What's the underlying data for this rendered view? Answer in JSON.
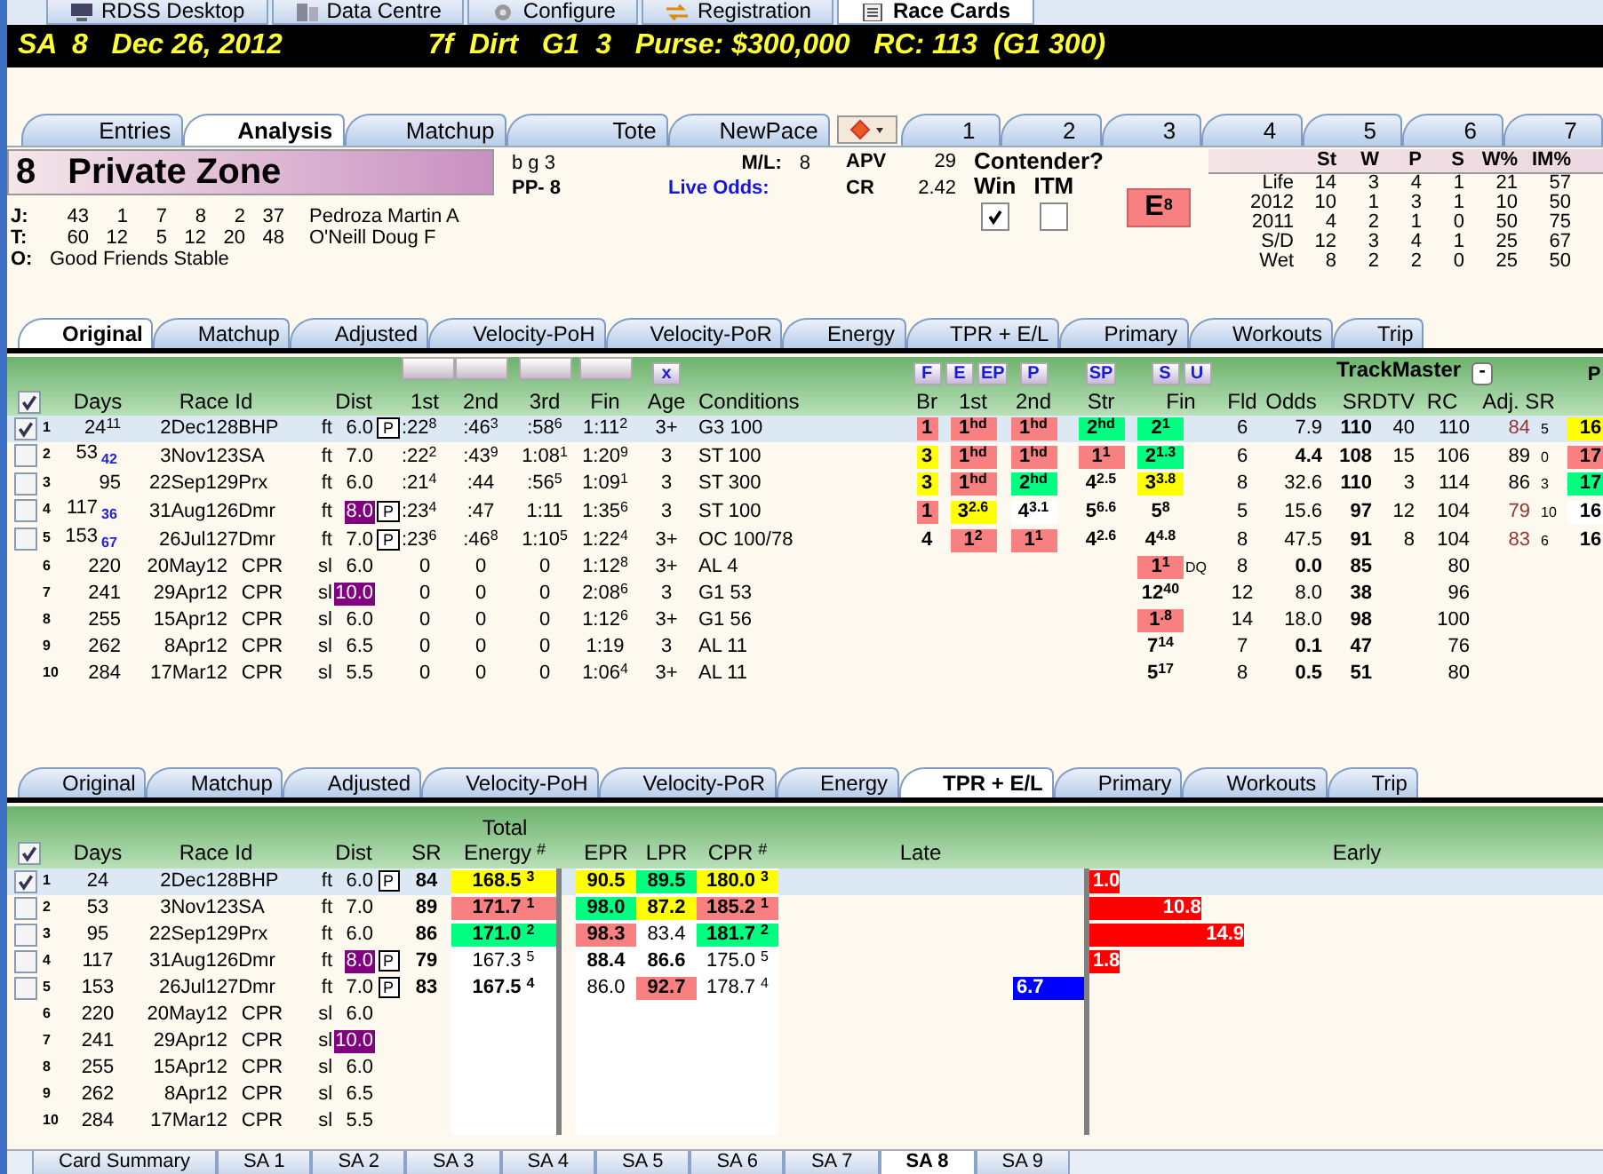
{
  "app_tabs": [
    {
      "label": "RDSS Desktop",
      "selected": false
    },
    {
      "label": "Data Centre",
      "selected": false
    },
    {
      "label": "Configure",
      "selected": false
    },
    {
      "label": "Registration",
      "selected": false
    },
    {
      "label": "Race Cards",
      "selected": true
    }
  ],
  "race_header": {
    "left": "SA  8   Dec 26, 2012",
    "right": "7f  Dirt   G1  3   Purse: $300,000   RC: 113  (G1 300)"
  },
  "horse_tabs": [
    {
      "label": "Entries",
      "selected": false
    },
    {
      "label": "Analysis",
      "selected": true
    },
    {
      "label": "Matchup",
      "selected": false
    },
    {
      "label": "Tote",
      "selected": false
    },
    {
      "label": "NewPace",
      "selected": false
    }
  ],
  "number_tabs": [
    {
      "label": "1",
      "selected": false
    },
    {
      "label": "2",
      "selected": false
    },
    {
      "label": "3",
      "selected": false
    },
    {
      "label": "4",
      "selected": false
    },
    {
      "label": "5",
      "selected": false
    },
    {
      "label": "6",
      "selected": false
    },
    {
      "label": "7",
      "selected": false
    }
  ],
  "horse": {
    "number": "8",
    "name": "Private Zone",
    "description": "b g 3",
    "post": "PP- 8",
    "ml_label": "M/L:",
    "ml": "8",
    "live_odds_label": "Live Odds:",
    "apv_label": "APV",
    "apv": "29",
    "cr_label": "CR",
    "cr": "2.42",
    "contender_label": "Contender?",
    "win_label": "Win",
    "win_checked": true,
    "itm_label": "ITM",
    "itm_checked": false,
    "style": "E",
    "style_number": "8",
    "connections": [
      {
        "label": "J:",
        "stats": [
          "43",
          "1",
          "7",
          "8",
          "2",
          "37"
        ],
        "name": "Pedroza Martin A"
      },
      {
        "label": "T:",
        "stats": [
          "60",
          "12",
          "5",
          "12",
          "20",
          "48"
        ],
        "name": "O'Neill Doug F"
      }
    ],
    "owner_label": "O:",
    "owner": "Good Friends Stable"
  },
  "record": {
    "columns": [
      "St",
      "W",
      "P",
      "S",
      "W%",
      "IM%"
    ],
    "rows": [
      {
        "label": "Life",
        "values": [
          "14",
          "3",
          "4",
          "1",
          "21",
          "57"
        ]
      },
      {
        "label": "2012",
        "values": [
          "10",
          "1",
          "3",
          "1",
          "10",
          "50"
        ]
      },
      {
        "label": "2011",
        "values": [
          "4",
          "2",
          "1",
          "0",
          "50",
          "75"
        ]
      },
      {
        "label": "S/D",
        "values": [
          "12",
          "3",
          "4",
          "1",
          "25",
          "67"
        ]
      },
      {
        "label": "Wet",
        "values": [
          "8",
          "2",
          "2",
          "0",
          "25",
          "50"
        ]
      }
    ]
  },
  "original_table": {
    "tabs": [
      {
        "label": "Original",
        "selected": true
      },
      {
        "label": "Matchup",
        "selected": false
      },
      {
        "label": "Adjusted",
        "selected": false
      },
      {
        "label": "Velocity-PoH",
        "selected": false
      },
      {
        "label": "Velocity-PoR",
        "selected": false
      },
      {
        "label": "Energy",
        "selected": false
      },
      {
        "label": "TPR + E/L",
        "selected": false
      },
      {
        "label": "Primary",
        "selected": false
      },
      {
        "label": "Workouts",
        "selected": false
      },
      {
        "label": "Trip",
        "selected": false
      }
    ],
    "all_checked": true,
    "clear_button": "x",
    "style_buttons": [
      "F",
      "E",
      "EP",
      "P",
      "SP",
      "S",
      "U"
    ],
    "trackmaster": "TrackMaster",
    "collapse_button": "-",
    "column_26": "P",
    "header": {
      "days": "Days",
      "race_id": "Race Id",
      "dist": "Dist",
      "first": "1st",
      "second": "2nd",
      "third": "3rd",
      "fin": "Fin",
      "age": "Age",
      "conditions": "Conditions",
      "br": "Br",
      "call1": "1st",
      "call2": "2nd",
      "str": "Str",
      "finish": "Fin",
      "fld": "Fld",
      "odds": "Odds",
      "sr": "SR",
      "dtv": "DTV",
      "rc": "RC",
      "adj_sr": "Adj. SR"
    },
    "rows": [
      {
        "num": "1",
        "checked": true,
        "selected": true,
        "days": "24$^{11}$",
        "date": "2Dec12",
        "track": "8BHP",
        "surface": "ft",
        "dist": {
          "t": "6.0"
        },
        "p": "P",
        "first": ":22$^{8}$",
        "second": ":46$^{3}$",
        "third": ":58$^{6}$",
        "fin": "1:11$^{2}$",
        "age": "3+",
        "conditions": "G3 100",
        "br": {
          "t": "1",
          "color": "#f88080"
        },
        "call1": {
          "t": "1$^{hd}$",
          "color": "#f88080"
        },
        "call2": {
          "t": "1$^{hd}$",
          "color": "#f88080"
        },
        "str": {
          "t": "2$^{hd}$",
          "color": "#00ff80"
        },
        "finish": {
          "t": "2$^{1}$",
          "color": "#00ff80"
        },
        "fld": "6",
        "odds": {
          "t": "7.9",
          "bold": false
        },
        "sr": "110",
        "dtv": "40",
        "rc": "110",
        "adj": {
          "t": "84",
          "n": "5",
          "color": "#993333"
        },
        "column_26": {
          "t": "16",
          "color": "#ffff00"
        }
      },
      {
        "num": "2",
        "checked": false,
        "selected": false,
        "days": "53",
        "gap": "42",
        "date": "3Nov12",
        "track": "3SA",
        "surface": "ft",
        "dist": {
          "t": "7.0"
        },
        "first": ":22$^{2}$",
        "second": ":43$^{9}$",
        "third": "1:08$^{1}$",
        "fin": "1:20$^{9}$",
        "age": "3",
        "conditions": "ST 100",
        "br": {
          "t": "3",
          "color": "#ffff00"
        },
        "call1": {
          "t": "1$^{hd}$",
          "color": "#f88080"
        },
        "call2": {
          "t": "1$^{hd}$",
          "color": "#f88080"
        },
        "str": {
          "t": "1$^{1}$",
          "color": "#f88080"
        },
        "finish": {
          "t": "2$^{1.3}$",
          "color": "#00ff80"
        },
        "fld": "6",
        "odds": {
          "t": "4.4",
          "bold": true
        },
        "sr": "108",
        "dtv": "15",
        "rc": "106",
        "adj": {
          "t": "89",
          "n": "0",
          "color": "#000000"
        },
        "column_26": {
          "t": "17",
          "color": "#f88080"
        }
      },
      {
        "num": "3",
        "checked": false,
        "selected": false,
        "days": "95",
        "date": "22Sep12",
        "track": "9Prx",
        "surface": "ft",
        "dist": {
          "t": "6.0"
        },
        "first": ":21$^{4}$",
        "second": ":44",
        "third": ":56$^{5}$",
        "fin": "1:09$^{1}$",
        "age": "3",
        "conditions": "ST 300",
        "br": {
          "t": "3",
          "color": "#ffff00"
        },
        "call1": {
          "t": "1$^{hd}$",
          "color": "#f88080"
        },
        "call2": {
          "t": "2$^{hd}$",
          "color": "#00ff80"
        },
        "str": {
          "t": "4$^{2.5}$"
        },
        "finish": {
          "t": "3$^{3.8}$",
          "color": "#ffff00"
        },
        "fld": "8",
        "odds": {
          "t": "32.6",
          "bold": false
        },
        "sr": "110",
        "dtv": "3",
        "rc": "114",
        "adj": {
          "t": "86",
          "n": "3",
          "color": "#000000"
        },
        "column_26": {
          "t": "17",
          "color": "#00ff80"
        }
      },
      {
        "num": "4",
        "checked": false,
        "selected": false,
        "days": "117",
        "gap": "36",
        "date": "31Aug12",
        "track": "6Dmr",
        "surface": "ft",
        "dist": {
          "t": "8.0",
          "color": "#800080"
        },
        "p": "P",
        "first": ":23$^{4}$",
        "second": ":47",
        "third": "1:11",
        "fin": "1:35$^{6}$",
        "age": "3",
        "conditions": "ST 100",
        "br": {
          "t": "1",
          "color": "#f88080"
        },
        "call1": {
          "t": "3$^{2.6}$",
          "color": "#ffff00"
        },
        "call2": {
          "t": "4$^{3.1}$",
          "color": "#ffffff"
        },
        "str": {
          "t": "5$^{6.6}$"
        },
        "finish": {
          "t": "5$^{8}$"
        },
        "fld": "5",
        "odds": {
          "t": "15.6",
          "bold": false
        },
        "sr": "97",
        "dtv": "12",
        "rc": "104",
        "adj": {
          "t": "79",
          "n": "10",
          "color": "#993333"
        },
        "column_26": {
          "t": "16",
          "color": "#ffffff"
        }
      },
      {
        "num": "5",
        "checked": false,
        "selected": false,
        "days": "153",
        "gap": "67",
        "date": "26Jul12",
        "track": "7Dmr",
        "surface": "ft",
        "dist": {
          "t": "7.0"
        },
        "p": "P",
        "first": ":23$^{6}$",
        "second": ":46$^{8}$",
        "third": "1:10$^{5}$",
        "fin": "1:22$^{4}$",
        "age": "3+",
        "conditions": "OC 100/78",
        "br": {
          "t": "4"
        },
        "call1": {
          "t": "1$^{2}$",
          "color": "#f88080"
        },
        "call2": {
          "t": "1$^{1}$",
          "color": "#f88080"
        },
        "str": {
          "t": "4$^{2.6}$"
        },
        "finish": {
          "t": "4$^{4.8}$"
        },
        "fld": "8",
        "odds": {
          "t": "47.5",
          "bold": false
        },
        "sr": "91",
        "dtv": "8",
        "rc": "104",
        "adj": {
          "t": "83",
          "n": "6",
          "color": "#993333"
        },
        "column_26": {
          "t": "16"
        }
      },
      {
        "num": "6",
        "selected": false,
        "days": "220",
        "date": "20May12",
        "track": "CPR",
        "surface": "sl",
        "dist": {
          "t": "6.0"
        },
        "first": "0",
        "second": "0",
        "third": "0",
        "fin": "1:12$^{8}$",
        "age": "3+",
        "conditions": "AL 4",
        "finish": {
          "t": "1$^{1}$",
          "color": "#f88080"
        },
        "note": "DQ",
        "fld": "8",
        "odds": {
          "t": "0.0",
          "bold": true
        },
        "sr": "85",
        "rc": "80"
      },
      {
        "num": "7",
        "selected": false,
        "days": "241",
        "date": "29Apr12",
        "track": "CPR",
        "surface": "sl",
        "dist": {
          "t": "10.0",
          "color": "#800080"
        },
        "first": "0",
        "second": "0",
        "third": "0",
        "fin": "2:08$^{6}$",
        "age": "3",
        "conditions": "G1 53",
        "finish": {
          "t": "12$^{40}$"
        },
        "fld": "12",
        "odds": {
          "t": "8.0",
          "bold": false
        },
        "sr": "38",
        "rc": "96"
      },
      {
        "num": "8",
        "selected": false,
        "days": "255",
        "date": "15Apr12",
        "track": "CPR",
        "surface": "sl",
        "dist": {
          "t": "6.0"
        },
        "first": "0",
        "second": "0",
        "third": "0",
        "fin": "1:12$^{6}$",
        "age": "3+",
        "conditions": "G1 56",
        "finish": {
          "t": "1$^{.8}$",
          "color": "#f88080"
        },
        "fld": "14",
        "odds": {
          "t": "18.0",
          "bold": false
        },
        "sr": "98",
        "rc": "100"
      },
      {
        "num": "9",
        "selected": false,
        "days": "262",
        "date": "8Apr12",
        "track": "CPR",
        "surface": "sl",
        "dist": {
          "t": "6.5"
        },
        "first": "0",
        "second": "0",
        "third": "0",
        "fin": "1:19",
        "age": "3",
        "conditions": "AL 11",
        "finish": {
          "t": "7$^{14}$"
        },
        "fld": "7",
        "odds": {
          "t": "0.1",
          "bold": true
        },
        "sr": "47",
        "rc": "76"
      },
      {
        "num": "10",
        "selected": false,
        "days": "284",
        "date": "17Mar12",
        "track": "CPR",
        "surface": "sl",
        "dist": {
          "t": "5.5"
        },
        "first": "0",
        "second": "0",
        "third": "0",
        "fin": "1:06$^{4}$",
        "age": "3+",
        "conditions": "AL 11",
        "finish": {
          "t": "5$^{17}$"
        },
        "fld": "8",
        "odds": {
          "t": "0.5",
          "bold": true
        },
        "sr": "51",
        "rc": "80"
      }
    ]
  },
  "tpr_table": {
    "tabs": [
      {
        "label": "Original",
        "selected": false
      },
      {
        "label": "Matchup",
        "selected": false
      },
      {
        "label": "Adjusted",
        "selected": false
      },
      {
        "label": "Velocity-PoH",
        "selected": false
      },
      {
        "label": "Velocity-PoR",
        "selected": false
      },
      {
        "label": "Energy",
        "selected": false
      },
      {
        "label": "TPR + E/L",
        "selected": true
      },
      {
        "label": "Primary",
        "selected": false
      },
      {
        "label": "Workouts",
        "selected": false
      },
      {
        "label": "Trip",
        "selected": false
      }
    ],
    "all_checked": true,
    "header": {
      "days": "Days",
      "race_id": "Race Id",
      "dist": "Dist",
      "sr": "SR",
      "energy_top": "Total",
      "energy": "Energy",
      "energy_rank": "#",
      "epr": "EPR",
      "lpr": "LPR",
      "cpr": "CPR",
      "cpr_rank": "#",
      "late": "Late",
      "early": "Early"
    },
    "rows": [
      {
        "num": "1",
        "checked": true,
        "selected": true,
        "days": "24",
        "date": "2Dec12",
        "track": "8BHP",
        "surface": "ft",
        "dist": {
          "t": "6.0"
        },
        "p": "P",
        "sr": "84",
        "energy": {
          "t": "168.5",
          "n": "3",
          "color": "#ffff00",
          "bold": true
        },
        "epr": {
          "t": "90.5",
          "color": "#ffff00",
          "bold": true
        },
        "lpr": {
          "t": "89.5",
          "color": "#00ff80",
          "bold": true
        },
        "cpr": {
          "t": "180.0",
          "n": "3",
          "color": "#ffff00",
          "bold": true
        },
        "early": {
          "t": "1.0",
          "level": 0.058
        }
      },
      {
        "num": "2",
        "checked": false,
        "selected": false,
        "days": "53",
        "date": "3Nov12",
        "track": "3SA",
        "surface": "ft",
        "dist": {
          "t": "7.0"
        },
        "sr": "89",
        "energy": {
          "t": "171.7",
          "n": "1",
          "color": "#f88080",
          "bold": true
        },
        "epr": {
          "t": "98.0",
          "color": "#00ff80",
          "bold": true
        },
        "lpr": {
          "t": "87.2",
          "color": "#ffff00",
          "bold": true
        },
        "cpr": {
          "t": "185.2",
          "n": "1",
          "color": "#f88080",
          "bold": true
        },
        "early": {
          "t": "10.8",
          "level": 0.213
        }
      },
      {
        "num": "3",
        "checked": false,
        "selected": false,
        "days": "95",
        "date": "22Sep12",
        "track": "9Prx",
        "surface": "ft",
        "dist": {
          "t": "6.0"
        },
        "sr": "86",
        "energy": {
          "t": "171.0",
          "n": "2",
          "color": "#00ff80",
          "bold": true
        },
        "epr": {
          "t": "98.3",
          "color": "#f88080",
          "bold": true
        },
        "lpr": {
          "t": "83.4",
          "bold": false
        },
        "cpr": {
          "t": "181.7",
          "n": "2",
          "color": "#00ff80",
          "bold": true
        },
        "early": {
          "t": "14.9",
          "level": 0.295
        }
      },
      {
        "num": "4",
        "checked": false,
        "selected": false,
        "days": "117",
        "date": "31Aug12",
        "track": "6Dmr",
        "surface": "ft",
        "dist": {
          "t": "8.0",
          "color": "#800080"
        },
        "p": "P",
        "sr": "79",
        "energy": {
          "t": "167.3",
          "n": "5",
          "bold": false
        },
        "epr": {
          "t": "88.4",
          "bold": true
        },
        "lpr": {
          "t": "86.6",
          "bold": true
        },
        "cpr": {
          "t": "175.0",
          "n": "5",
          "bold": false
        },
        "early": {
          "t": "1.8",
          "level": 0.058
        }
      },
      {
        "num": "5",
        "checked": false,
        "selected": false,
        "days": "153",
        "date": "26Jul12",
        "track": "7Dmr",
        "surface": "ft",
        "dist": {
          "t": "7.0"
        },
        "p": "P",
        "sr": "83",
        "energy": {
          "t": "167.5",
          "n": "4",
          "bold": true
        },
        "epr": {
          "t": "86.0",
          "bold": false
        },
        "lpr": {
          "t": "92.7",
          "color": "#f88080",
          "bold": true
        },
        "cpr": {
          "t": "178.7",
          "n": "4",
          "bold": false
        },
        "late": {
          "t": "6.7",
          "level": 0.233
        }
      },
      {
        "num": "6",
        "selected": false,
        "days": "220",
        "date": "20May12",
        "track": "CPR",
        "surface": "sl",
        "dist": {
          "t": "6.0"
        }
      },
      {
        "num": "7",
        "selected": false,
        "days": "241",
        "date": "29Apr12",
        "track": "CPR",
        "surface": "sl",
        "dist": {
          "t": "10.0",
          "color": "#800080"
        }
      },
      {
        "num": "8",
        "selected": false,
        "days": "255",
        "date": "15Apr12",
        "track": "CPR",
        "surface": "sl",
        "dist": {
          "t": "6.0"
        }
      },
      {
        "num": "9",
        "selected": false,
        "days": "262",
        "date": "8Apr12",
        "track": "CPR",
        "surface": "sl",
        "dist": {
          "t": "6.5"
        }
      },
      {
        "num": "10",
        "selected": false,
        "days": "284",
        "date": "17Mar12",
        "track": "CPR",
        "surface": "sl",
        "dist": {
          "t": "5.5"
        }
      }
    ]
  },
  "race_tabs": [
    {
      "label": "Card Summary",
      "selected": false
    },
    {
      "label": "SA 1",
      "selected": false
    },
    {
      "label": "SA 2",
      "selected": false
    },
    {
      "label": "SA 3",
      "selected": false
    },
    {
      "label": "SA 4",
      "selected": false
    },
    {
      "label": "SA 5",
      "selected": false
    },
    {
      "label": "SA 6",
      "selected": false
    },
    {
      "label": "SA 7",
      "selected": false
    },
    {
      "label": "SA 8",
      "selected": true
    },
    {
      "label": "SA 9",
      "selected": false
    }
  ]
}
